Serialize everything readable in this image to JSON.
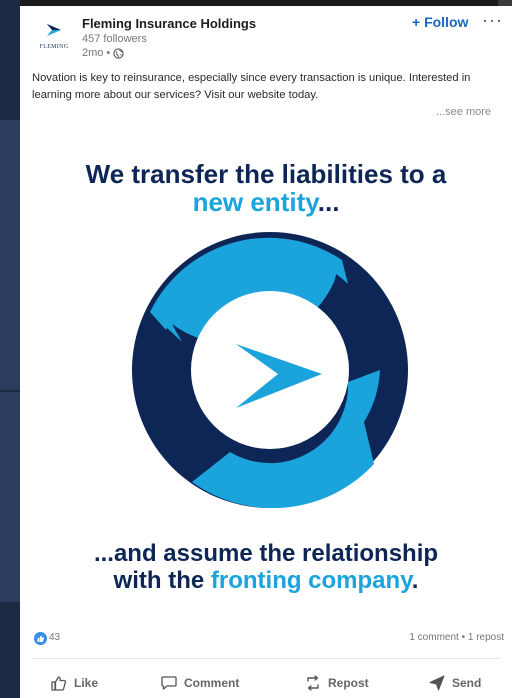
{
  "post": {
    "company_name": "Fleming Insurance Holdings",
    "logo_word": "FLEMING",
    "followers": "457 followers",
    "age": "2mo",
    "separator": "•",
    "follow_label": "+ Follow",
    "more_label": "···",
    "text": "Novation is key to reinsurance, especially since every transaction is unique. Interested in learning more about our services? Visit our website today.",
    "see_more": "...see more"
  },
  "graphic": {
    "headline_part1": "We transfer the liabilities to a",
    "headline_part2": "new entity",
    "headline_part3": "...",
    "footline_part1": "...and assume the relationship",
    "footline_part2": "with the ",
    "footline_part3": "fronting company",
    "footline_part4": ".",
    "colors": {
      "dark": "#0d2656",
      "light": "#1ba3dc",
      "brand_blue": "#1a66c2"
    }
  },
  "stats": {
    "reaction_count": "43",
    "engagement": "1 comment • 1 repost"
  },
  "actions": [
    {
      "label": "Like",
      "icon": "thumbs-up-icon"
    },
    {
      "label": "Comment",
      "icon": "comment-icon"
    },
    {
      "label": "Repost",
      "icon": "repost-icon"
    },
    {
      "label": "Send",
      "icon": "send-icon"
    }
  ]
}
